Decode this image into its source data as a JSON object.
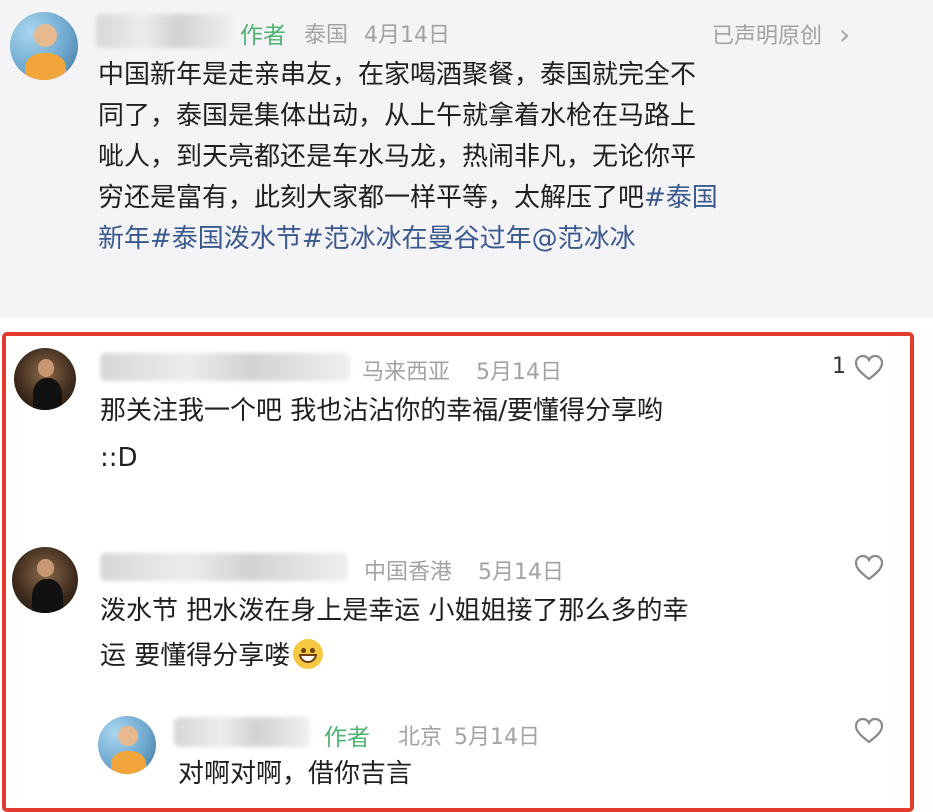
{
  "post": {
    "author_badge": "作者",
    "location": "泰国",
    "date": "4月14日",
    "original_label": "已声明原创",
    "chevron": "›",
    "lines": [
      "中国新年是走亲串友，在家喝酒聚餐，泰国就完全不",
      "同了，泰国是集体出动，从上午就拿着水枪在马路上",
      "呲人，到天亮都还是车水马龙，热闹非凡，无论你平"
    ],
    "line4_text": "穷还是富有，此刻大家都一样平等，太解压了吧",
    "line4_tag": "#泰国",
    "line5_tag": "新年#泰国泼水节#范冰冰在曼谷过年@范冰冰"
  },
  "comments": [
    {
      "location": "马来西亚",
      "date": "5月14日",
      "likes": "1",
      "lines": [
        "那关注我一个吧  我也沾沾你的幸福/要懂得分享哟",
        "::D"
      ]
    },
    {
      "location": "中国香港",
      "date": "5月14日",
      "lines": [
        "泼水节  把水泼在身上是幸运  小姐姐接了那么多的幸",
        "运  要懂得分享喽"
      ],
      "emoji": "grinning-face-emoji"
    }
  ],
  "reply": {
    "author_badge": "作者",
    "location": "北京",
    "date": "5月14日",
    "text": "对啊对啊，借你吉言"
  },
  "colors": {
    "author_green": "#4fb272",
    "hashtag_blue": "#3a5a8f",
    "highlight_red": "#e23a2f",
    "meta_gray": "#a3a3a3"
  }
}
